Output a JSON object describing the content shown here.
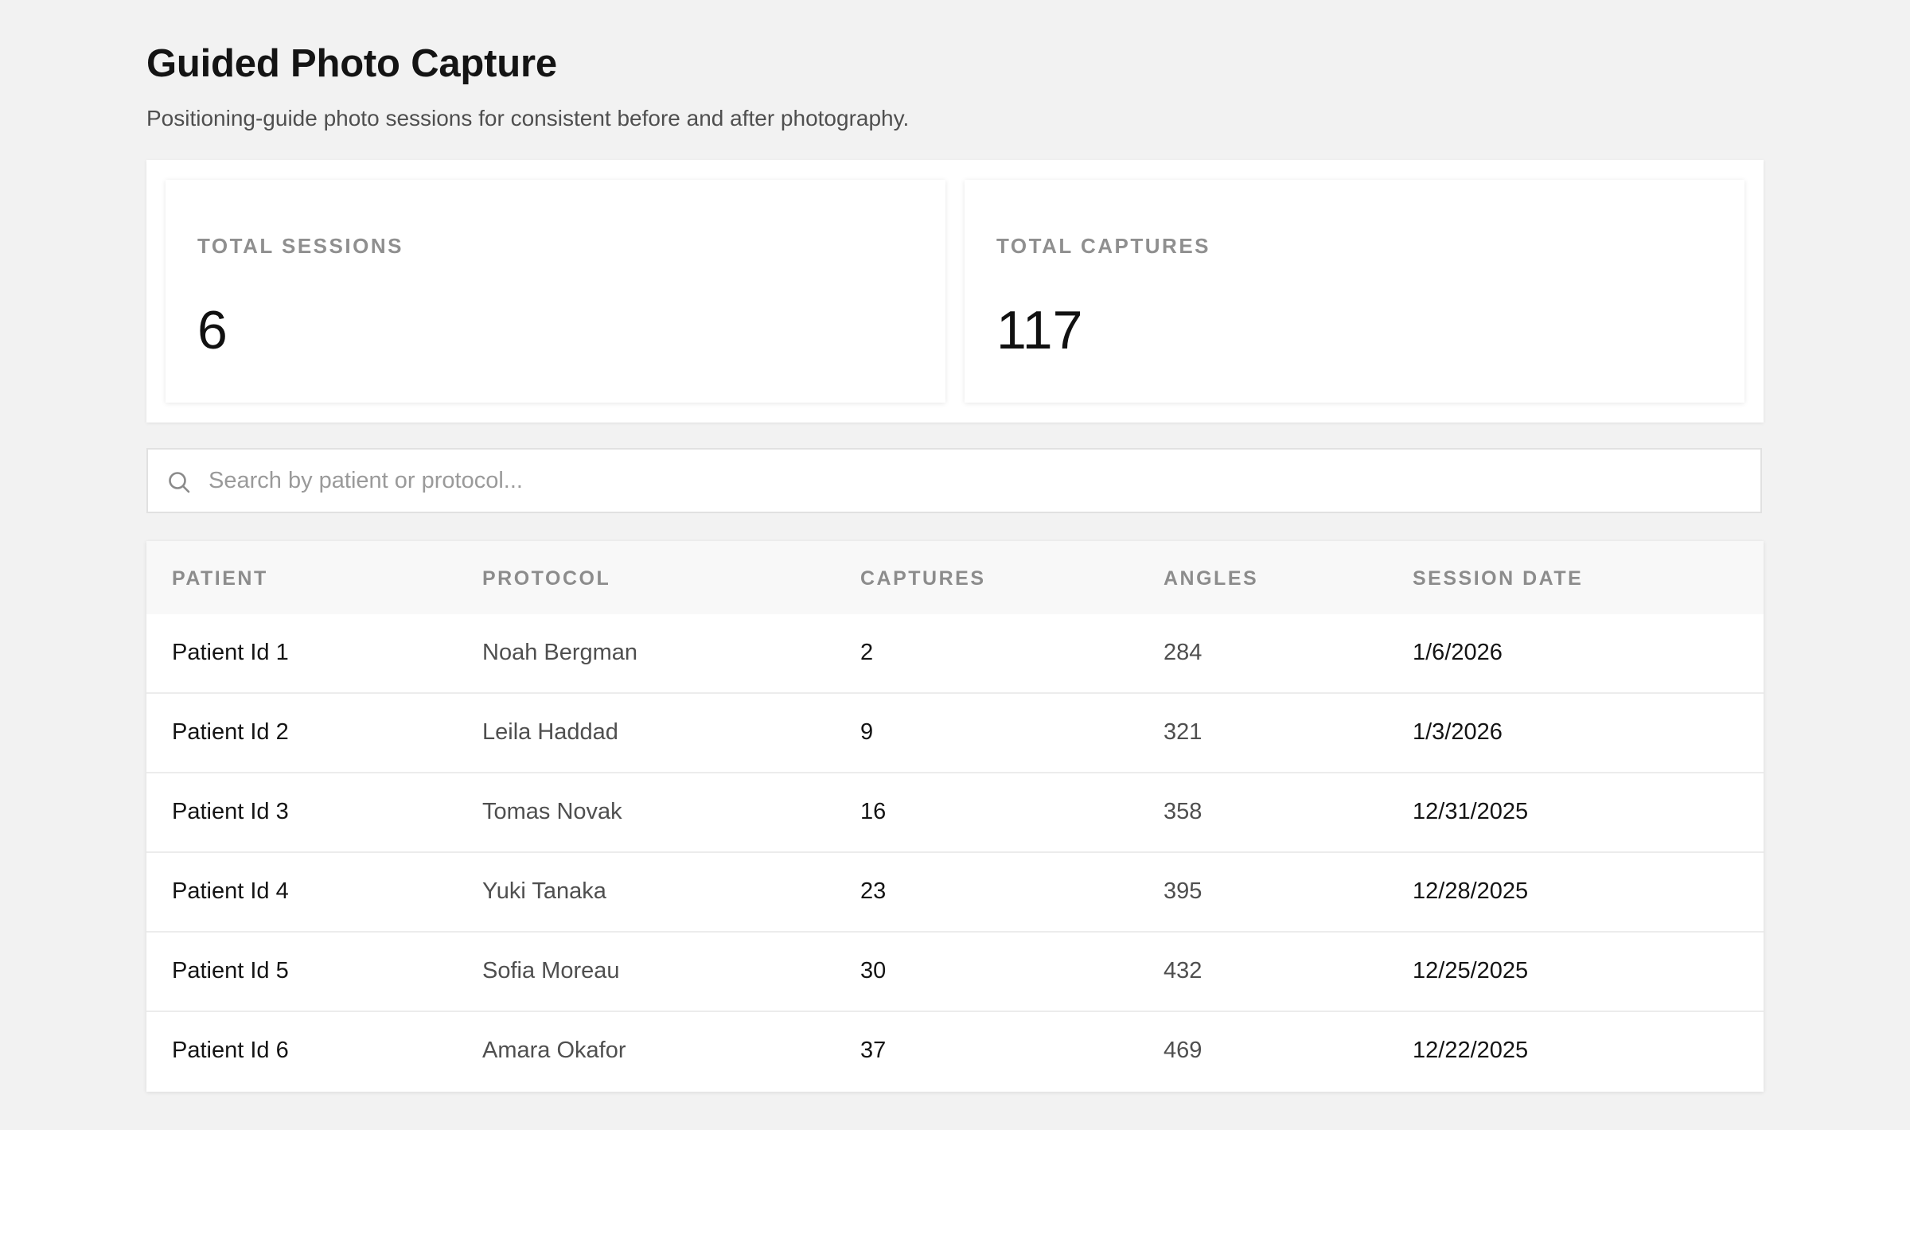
{
  "page": {
    "title": "Guided Photo Capture",
    "subtitle": "Positioning-guide photo sessions for consistent before and after photography."
  },
  "stats": {
    "total_sessions": {
      "label": "TOTAL SESSIONS",
      "value": "6"
    },
    "total_captures": {
      "label": "TOTAL CAPTURES",
      "value": "117"
    }
  },
  "search": {
    "icon": "search-icon",
    "placeholder": "Search by patient or protocol...",
    "value": ""
  },
  "table": {
    "columns": [
      "PATIENT",
      "PROTOCOL",
      "CAPTURES",
      "ANGLES",
      "SESSION DATE"
    ],
    "rows": [
      {
        "patient": "Patient Id 1",
        "protocol": "Noah Bergman",
        "captures": "2",
        "angles": "284",
        "session_date": "1/6/2026"
      },
      {
        "patient": "Patient Id 2",
        "protocol": "Leila Haddad",
        "captures": "9",
        "angles": "321",
        "session_date": "1/3/2026"
      },
      {
        "patient": "Patient Id 3",
        "protocol": "Tomas Novak",
        "captures": "16",
        "angles": "358",
        "session_date": "12/31/2025"
      },
      {
        "patient": "Patient Id 4",
        "protocol": "Yuki Tanaka",
        "captures": "23",
        "angles": "395",
        "session_date": "12/28/2025"
      },
      {
        "patient": "Patient Id 5",
        "protocol": "Sofia Moreau",
        "captures": "30",
        "angles": "432",
        "session_date": "12/25/2025"
      },
      {
        "patient": "Patient Id 6",
        "protocol": "Amara Okafor",
        "captures": "37",
        "angles": "469",
        "session_date": "12/22/2025"
      }
    ]
  },
  "colors": {
    "page_background": "#f2f2f2",
    "card_background": "#ffffff",
    "header_text": "#141414",
    "muted_text": "#8c8c8c"
  }
}
